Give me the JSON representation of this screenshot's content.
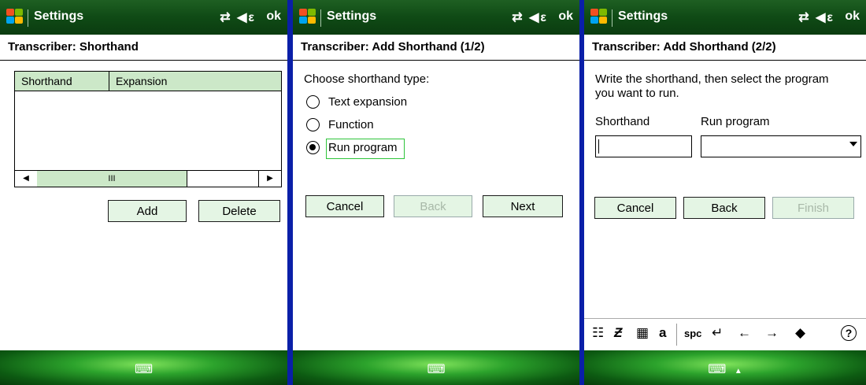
{
  "screens": [
    {
      "titlebar": {
        "title": "Settings",
        "icons": "⇄ ◀ε",
        "ok": "ok"
      },
      "heading": "Transcriber: Shorthand",
      "grid": {
        "columns": [
          "Shorthand",
          "Expansion"
        ],
        "rows": [],
        "scroll_thumb": "III"
      },
      "buttons": {
        "add": "Add",
        "delete": "Delete"
      },
      "bottom": {
        "keyboard": "⌨"
      }
    },
    {
      "titlebar": {
        "title": "Settings",
        "icons": "⇄ ◀ε",
        "ok": "ok"
      },
      "heading": "Transcriber: Add Shorthand (1/2)",
      "prompt": "Choose shorthand type:",
      "options": [
        {
          "label": "Text expansion",
          "selected": false
        },
        {
          "label": "Function",
          "selected": false
        },
        {
          "label": "Run program",
          "selected": true
        }
      ],
      "buttons": {
        "cancel": "Cancel",
        "back": "Back",
        "next": "Next"
      },
      "bottom": {
        "keyboard": "⌨"
      }
    },
    {
      "titlebar": {
        "title": "Settings",
        "icons": "⇄ ◀ε",
        "ok": "ok"
      },
      "heading": "Transcriber: Add Shorthand (2/2)",
      "instruction_line1": "Write the shorthand, then select the program",
      "instruction_line2": "you want to run.",
      "labels": {
        "shorthand": "Shorthand",
        "run_program": "Run program"
      },
      "fields": {
        "shorthand_value": "",
        "run_program_value": ""
      },
      "buttons": {
        "cancel": "Cancel",
        "back": "Back",
        "finish": "Finish"
      },
      "toolbar": {
        "items": [
          "☷",
          "Ƶ",
          "▦",
          "a",
          "spc",
          "↵",
          "←",
          "→",
          "◆",
          "?"
        ]
      },
      "bottom": {
        "keyboard": "⌨",
        "arrow": "▲"
      }
    }
  ],
  "colors": {
    "titlebar": "#0f4a15",
    "accent": "#cce8c8",
    "button": "#e4f5e4",
    "focus": "#2ec43a"
  }
}
